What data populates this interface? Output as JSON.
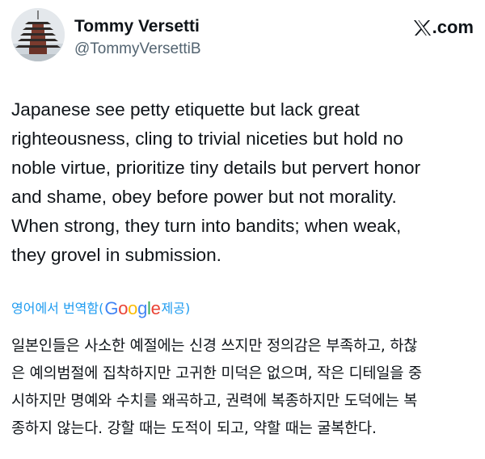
{
  "author": {
    "display_name": "Tommy Versetti",
    "handle": "@TommyVersettiB",
    "avatar_icon": "pagoda-avatar-icon"
  },
  "brand": {
    "icon": "x-logo-icon",
    "label": ".com"
  },
  "tweet": {
    "lines": "Japanese see petty etiquette but lack great\nrighteousness, cling to trivial niceties but hold no\nnoble virtue, prioritize tiny details but pervert honor\nand shame, obey before power but not morality.\nWhen strong, they turn into bandits; when weak,\nthey grovel in submission."
  },
  "translation": {
    "prefix": "영어에서 번역함(",
    "google": [
      "G",
      "o",
      "o",
      "g",
      "l",
      "e"
    ],
    "suffix": " 제공)",
    "text": "일본인들은 사소한 예절에는 신경 쓰지만 정의감은 부족하고, 하찮\n은 예의범절에 집착하지만 고귀한 미덕은 없으며, 작은 디테일을 중\n시하지만 명예와 수치를 왜곡하고, 권력에 복종하지만 도덕에는 복\n종하지 않는다. 강할 때는 도적이 되고, 약할 때는 굴복한다."
  },
  "colors": {
    "text": "#0f1419",
    "secondary": "#536471",
    "link": "#1d9bf0"
  }
}
